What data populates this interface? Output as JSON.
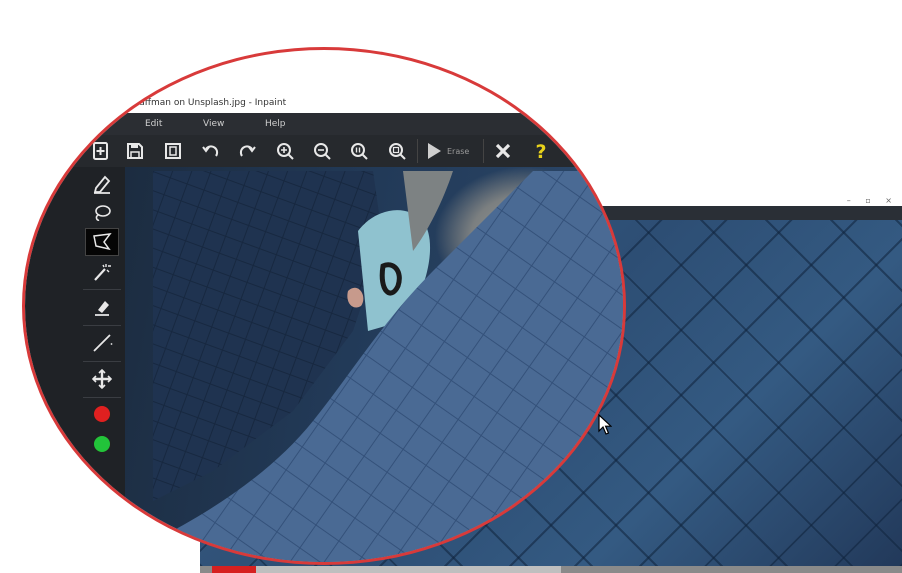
{
  "window": {
    "title": "Caffman on Unsplash.jpg - Inpaint",
    "controls": "– ▫ ×"
  },
  "menu": {
    "items": [
      "Edit",
      "View",
      "Help"
    ]
  },
  "toolbar": {
    "buttons": [
      "new-file-icon",
      "save-icon",
      "save-as-icon",
      "undo-icon",
      "redo-icon",
      "zoom-in-icon",
      "zoom-out-icon",
      "zoom-actual-icon",
      "zoom-fit-icon",
      "erase-icon",
      "close-icon",
      "help-icon"
    ],
    "erase_label": "Erase"
  },
  "sidebar": {
    "tools": [
      "marker-icon",
      "lasso-icon",
      "polygonal-lasso-icon",
      "magic-wand-icon",
      "eraser-icon",
      "line-icon",
      "move-icon"
    ],
    "active_tool": "polygonal-lasso-icon",
    "colors": [
      "#e02020",
      "#22c43a"
    ]
  },
  "colors": {
    "lens_border": "#d83a3a",
    "help_icon": "#e8d21b",
    "status_fill": "#d62020"
  }
}
